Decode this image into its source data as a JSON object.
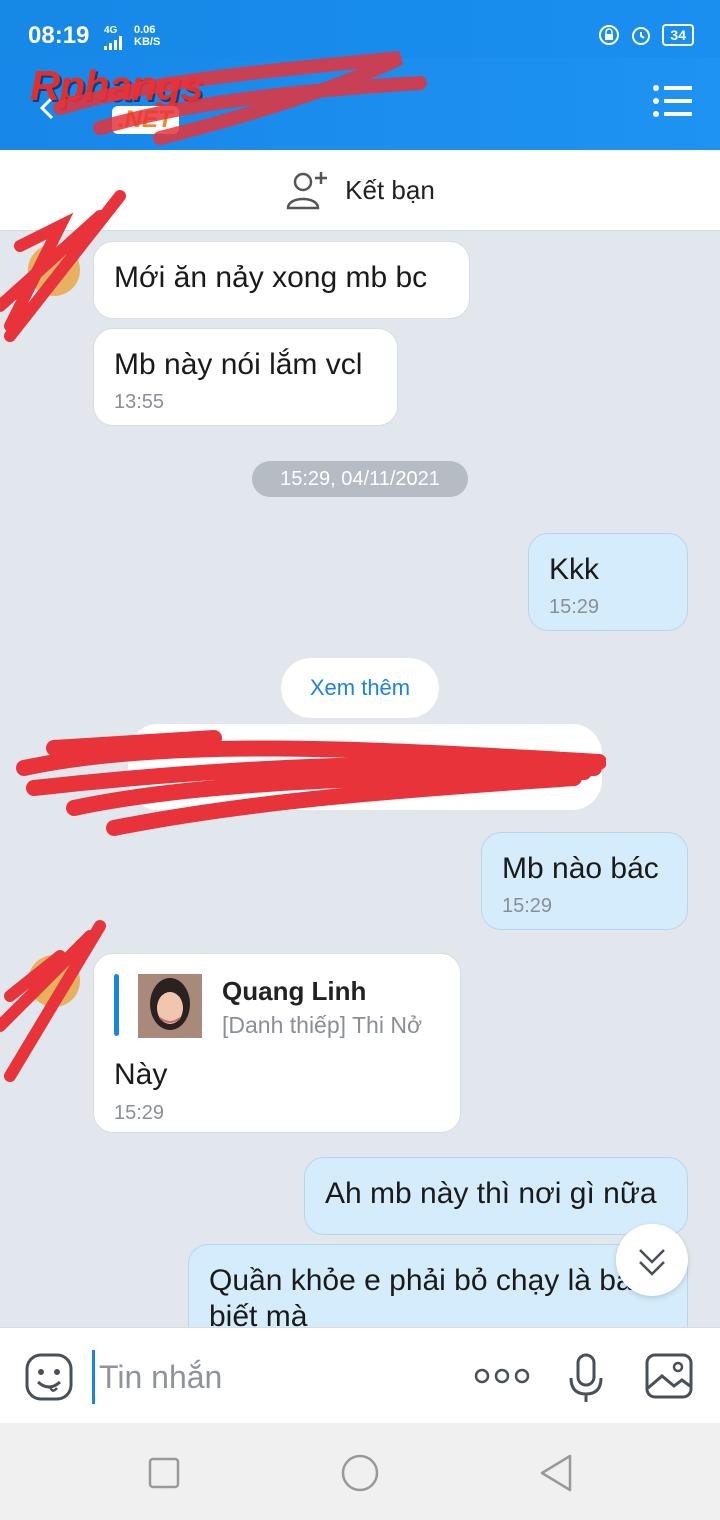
{
  "status": {
    "time": "08:19",
    "network": "4G",
    "speed_value": "0.06",
    "speed_unit": "KB/S",
    "battery": "34"
  },
  "header": {
    "logo_text": "Rphangs",
    "logo_sub": ".NET"
  },
  "friend_bar": {
    "label": "Kết bạn"
  },
  "messages": [
    {
      "text": "Mới ăn nảy xong mb bc"
    },
    {
      "text": "Mb này nói lắm vcl",
      "time": "13:55"
    },
    {
      "text": "Kkk",
      "time": "15:29"
    },
    {
      "text": "Mb nào bác",
      "time": "15:29"
    },
    {
      "text": "Ah mb này thì nơi gì nữa"
    },
    {
      "text": "Quần khỏe e phải bỏ chạy là bác biết mà"
    }
  ],
  "date_divider": "15:29, 04/11/2021",
  "see_more": "Xem thêm",
  "contact_card": {
    "name": "Quang Linh",
    "subtitle": "[Danh thiếp] Thi Nở",
    "body": "Này",
    "time": "15:29"
  },
  "composer": {
    "placeholder": "Tin nhắn"
  },
  "colors": {
    "accent": "#1b84e0",
    "header_bg": "#1787e8",
    "bubble_out": "#d4ecfb",
    "chat_bg": "#e2e7ee"
  }
}
